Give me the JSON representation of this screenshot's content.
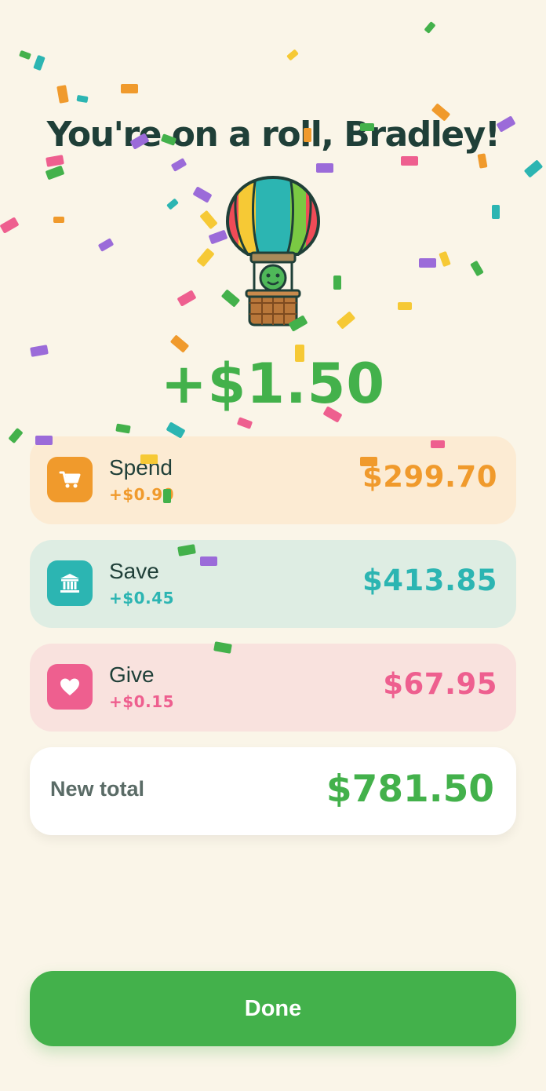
{
  "header": {
    "title": "You're on a roll, Bradley!"
  },
  "reward": {
    "amount": "+$1.50"
  },
  "accounts": [
    {
      "key": "spend",
      "label": "Spend",
      "delta": "+$0.90",
      "balance": "$299.70",
      "icon": "shopping-cart-icon",
      "color": "#f09a2c",
      "bg": "#fcebd3"
    },
    {
      "key": "save",
      "label": "Save",
      "delta": "+$0.45",
      "balance": "$413.85",
      "icon": "bank-icon",
      "color": "#2cb5b2",
      "bg": "#deede3"
    },
    {
      "key": "give",
      "label": "Give",
      "delta": "+$0.15",
      "balance": "$67.95",
      "icon": "heart-icon",
      "color": "#ee5f8f",
      "bg": "#f9e2de"
    }
  ],
  "total": {
    "label": "New total",
    "value": "$781.50"
  },
  "actions": {
    "done_label": "Done"
  },
  "illustration": {
    "icon": "hot-air-balloon-icon"
  },
  "colors": {
    "background": "#faf5e8",
    "accent_green": "#43b14b",
    "title": "#1f3f38",
    "confetti": [
      "#43b14b",
      "#2cb5b2",
      "#f09a2c",
      "#ee5f8f",
      "#9b6bd9",
      "#f6c935"
    ]
  }
}
